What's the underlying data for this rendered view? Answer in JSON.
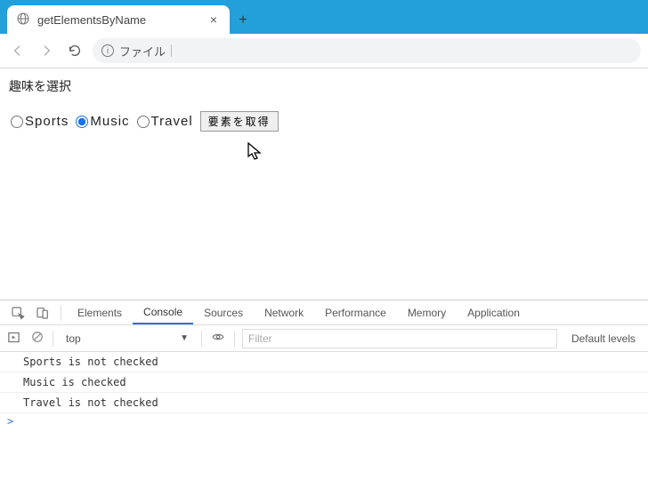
{
  "browser": {
    "tab_title": "getElementsByName",
    "url_label": "ファイル",
    "new_tab": "+"
  },
  "page": {
    "heading": "趣味を選択",
    "options": [
      {
        "label": "Sports",
        "checked": false
      },
      {
        "label": "Music",
        "checked": true
      },
      {
        "label": "Travel",
        "checked": false
      }
    ],
    "button_label": "要素を取得"
  },
  "devtools": {
    "tabs": [
      "Elements",
      "Console",
      "Sources",
      "Network",
      "Performance",
      "Memory",
      "Application"
    ],
    "active_tab": "Console",
    "context": "top",
    "filter_placeholder": "Filter",
    "levels_label": "Default levels",
    "console_lines": [
      "Sports is not checked",
      "Music is checked",
      "Travel is not checked"
    ],
    "prompt": ">"
  }
}
